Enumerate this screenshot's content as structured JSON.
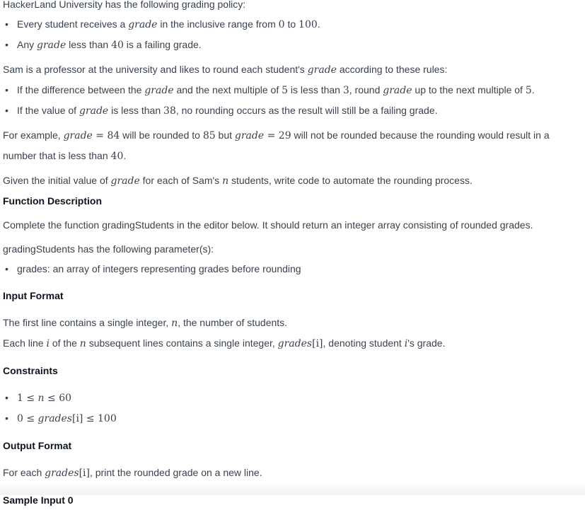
{
  "intro": "HackerLand University has the following grading policy:",
  "policy": {
    "b1_pre": "Every student receives a ",
    "b1_var": "grade",
    "b1_mid": " in the inclusive range from ",
    "b1_lo": "0",
    "b1_to": " to ",
    "b1_hi": "100",
    "b1_end": ".",
    "b2_pre": "Any ",
    "b2_var": "grade",
    "b2_mid": " less than ",
    "b2_num": "40",
    "b2_end": " is a failing grade."
  },
  "sam": {
    "pre": "Sam is a professor at the university and likes to round each student's ",
    "var": "grade",
    "post": " according to these rules:"
  },
  "rules": {
    "r1_a": "If the difference between the ",
    "r1_var": "grade",
    "r1_b": " and the next multiple of ",
    "r1_five": "5",
    "r1_c": " is less than ",
    "r1_three": "3",
    "r1_d": ", round ",
    "r1_var2": "grade",
    "r1_e": " up to the next multiple of ",
    "r1_five2": "5",
    "r1_f": ".",
    "r2_a": "If the value of ",
    "r2_var": "grade",
    "r2_b": " is less than ",
    "r2_num": "38",
    "r2_c": ", no rounding occurs as the result will still be a failing grade."
  },
  "example": {
    "a": "For example, ",
    "var1": "grade",
    "eq1": " = 84",
    "b": " will be rounded to ",
    "n85": "85",
    "c": " but ",
    "var2": "grade",
    "eq2": " = 29",
    "d": " will not be rounded because the rounding would result in a number that is less than ",
    "n40": "40",
    "e": "."
  },
  "given": {
    "a": "Given the initial value of ",
    "var": "grade",
    "b": " for each of Sam's ",
    "n": "n",
    "c": " students, write code to automate the rounding process."
  },
  "function_description": {
    "heading": "Function Description",
    "text": "Complete the function gradingStudents in the editor below. It should return an integer array consisting of rounded grades.",
    "params_intro": "gradingStudents has the following parameter(s):",
    "param1": "grades: an array of integers representing grades before rounding"
  },
  "input_format": {
    "heading": "Input Format",
    "l1_a": "The first line contains a single integer, ",
    "l1_n": "n",
    "l1_b": ", the number of students.",
    "l2_a": "Each line ",
    "l2_i": "i",
    "l2_b": " of the ",
    "l2_n": "n",
    "l2_c": " subsequent lines contains a single integer, ",
    "l2_g": "grades",
    "l2_idx": "[i]",
    "l2_d": ", denoting student ",
    "l2_i2": "i",
    "l2_e": "'s grade."
  },
  "constraints": {
    "heading": "Constraints",
    "c1_lo": "1 ≤ ",
    "c1_n": "n",
    "c1_hi": " ≤ 60",
    "c2_lo": "0 ≤ ",
    "c2_g": "grades",
    "c2_idx": "[i]",
    "c2_hi": " ≤ 100"
  },
  "output_format": {
    "heading": "Output Format",
    "a": "For each ",
    "g": "grades",
    "idx": "[i]",
    "b": ", print the rounded grade on a new line."
  },
  "sample_heading": "Sample Input 0"
}
